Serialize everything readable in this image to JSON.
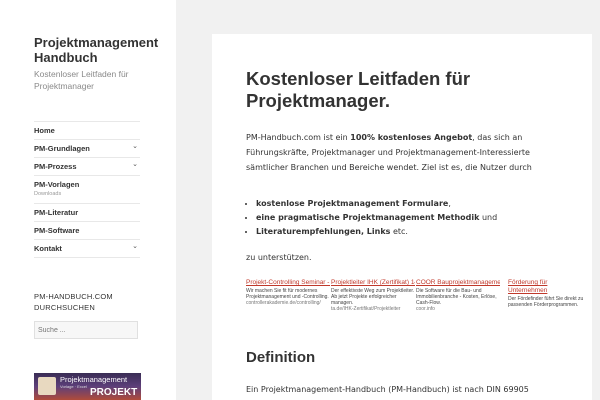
{
  "site": {
    "title": "Projektmanagement Handbuch",
    "description": "Kostenloser Leitfaden für Projektmanager"
  },
  "nav": {
    "items": [
      {
        "label": "Home",
        "has_children": false,
        "sub": ""
      },
      {
        "label": "PM-Grundlagen",
        "has_children": true,
        "sub": ""
      },
      {
        "label": "PM-Prozess",
        "has_children": true,
        "sub": ""
      },
      {
        "label": "PM-Vorlagen",
        "has_children": false,
        "sub": "Downloads"
      },
      {
        "label": "PM-Literatur",
        "has_children": false,
        "sub": ""
      },
      {
        "label": "PM-Software",
        "has_children": false,
        "sub": ""
      },
      {
        "label": "Kontakt",
        "has_children": true,
        "sub": ""
      }
    ],
    "chevron": "⌄"
  },
  "search": {
    "title": "PM-HANDBUCH.COM DURCHSUCHEN",
    "placeholder": "Suche ..."
  },
  "banner": {
    "line1": "Projektmanagement",
    "line2": "Vorlage · Excel",
    "line3": "PROJEKT"
  },
  "article": {
    "heading": "Kostenloser Leitfaden für Projektmanager.",
    "intro_pre": "PM-Handbuch.com ist ein ",
    "intro_bold": "100% kostenloses Angebot",
    "intro_post": ", das sich an Führungskräfte, Projektmanager und Projektmanagement-Interessierte sämtlicher Branchen und Bereiche wendet. Ziel ist es, die Nutzer durch",
    "features": [
      {
        "bold": "kostenlose Projektmanagement Formulare",
        "rest": ","
      },
      {
        "bold": "eine pragmatische Projektmanagement Methodik",
        "rest": " und"
      },
      {
        "bold": "Literaturempfehlungen, Links",
        "rest": " etc."
      }
    ],
    "outro": "zu unterstützen.",
    "ads": [
      {
        "title": "Projekt-Controlling Seminar - Mit Abschlusszertifizierung",
        "desc": "Wir machen Sie fit für modernes Projektmanagement und -Controlling.",
        "url": "controllerakademie.de/controlling/"
      },
      {
        "title": "Projektleiter IHK (Zertifikat) 14-tägiger Intensiv-Lehrgang",
        "desc": "Der effektivste Weg zum Projektleiter. Ab jetzt Projekte erfolgreicher managen.",
        "url": "ta.de/IHK-Zertifikat/Projektleiter"
      },
      {
        "title": "COOR Bauprojektmanagement - Infos zur Software anfordern",
        "desc": "Die Software für die Bau- und Immobilienbranche - Kosten, Erlöse, Cash-Flow.",
        "url": "coor.info"
      },
      {
        "title": "Förderung für Unternehmen",
        "desc": "Der Fördefinder führt Sie direkt zu passenden Förderprogrammen.",
        "url": ""
      }
    ],
    "definition_heading": "Definition",
    "definition_text": "Ein Projektmanagement-Handbuch (PM-Handbuch) ist nach DIN 69905"
  }
}
